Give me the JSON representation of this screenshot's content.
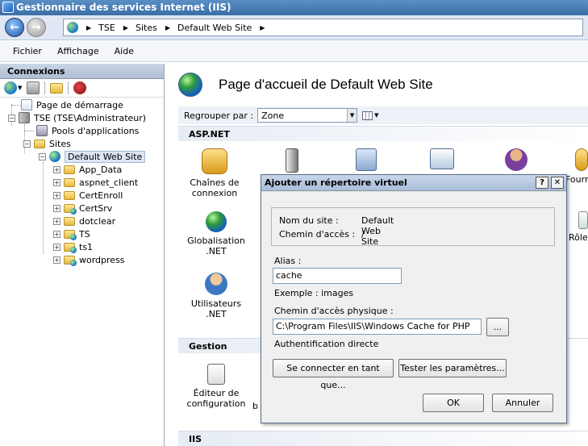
{
  "window": {
    "title": "Gestionnaire des services Internet (IIS)"
  },
  "breadcrumb": {
    "items": [
      "TSE",
      "Sites",
      "Default Web Site"
    ]
  },
  "menu": {
    "items": [
      "Fichier",
      "Affichage",
      "Aide"
    ]
  },
  "connections": {
    "header": "Connexions",
    "tree": {
      "start_page": "Page de démarrage",
      "server": "TSE (TSE\\Administrateur)",
      "app_pools": "Pools d'applications",
      "sites": "Sites",
      "default_site": "Default Web Site",
      "children": [
        "App_Data",
        "aspnet_client",
        "CertEnroll",
        "CertSrv",
        "dotclear",
        "TS",
        "ts1",
        "wordpress"
      ]
    }
  },
  "main": {
    "title": "Page d'accueil de Default Web Site",
    "group_label": "Regrouper par :",
    "group_value": "Zone",
    "sections": {
      "aspnet": "ASP.NET",
      "gestion": "Gestion",
      "iis": "IIS"
    },
    "features": {
      "chaines": "Chaînes de connexion",
      "globalisation": "Globalisation .NET",
      "utilisateurs": "Utilisateurs .NET",
      "editeur": "Éditeur de configuration",
      "fourn": "Fourni",
      "roles": "Rôles",
      "b_fragment": "b"
    }
  },
  "dialog": {
    "title": "Ajouter un répertoire virtuel",
    "help_btn": "?",
    "close_btn": "✕",
    "site_name_label": "Nom du site :",
    "site_name_value": "Default Web Site",
    "path_label": "Chemin d'accès :",
    "path_value": "/",
    "alias_label": "Alias :",
    "alias_value": "cache",
    "example": "Exemple : images",
    "physical_path_label": "Chemin d'accès physique :",
    "physical_path_value": "C:\\Program Files\\IIS\\Windows Cache for PHP",
    "browse_btn": "...",
    "auth_label": "Authentification directe",
    "connect_as_btn": "Se connecter en tant que...",
    "test_btn": "Tester les paramètres...",
    "ok_btn": "OK",
    "cancel_btn": "Annuler"
  }
}
